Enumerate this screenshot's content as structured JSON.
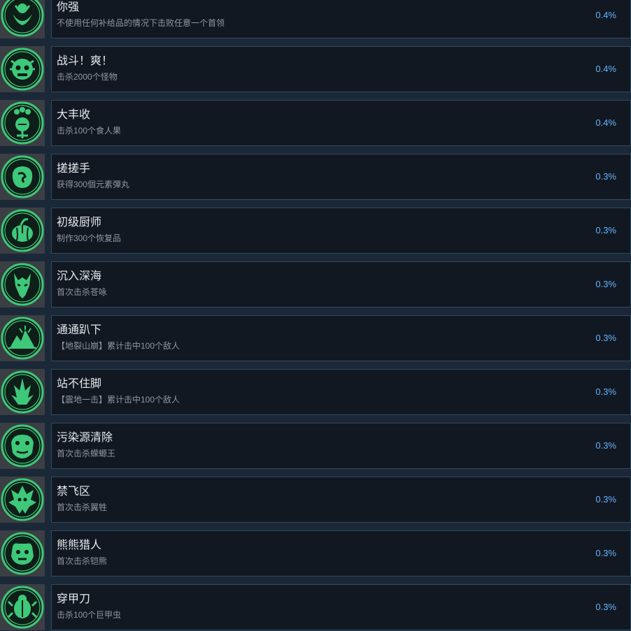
{
  "achievements": [
    {
      "icon": "leaf-flower-icon",
      "title": "你强",
      "desc": "不使用任何补给品的情况下击败任意一个首领",
      "percent": "0.4%"
    },
    {
      "icon": "skull-icon",
      "title": "战斗！爽！",
      "desc": "击杀2000个怪物",
      "percent": "0.4%"
    },
    {
      "icon": "carnivorous-plant-icon",
      "title": "大丰收",
      "desc": "击杀100个食人果",
      "percent": "0.4%"
    },
    {
      "icon": "flower-swirl-icon",
      "title": "搓搓手",
      "desc": "获得300個元素彈丸",
      "percent": "0.3%"
    },
    {
      "icon": "pumpkin-icon",
      "title": "初级厨师",
      "desc": "制作300个恢复品",
      "percent": "0.3%"
    },
    {
      "icon": "dragon-head-icon",
      "title": "沉入深海",
      "desc": "首次击杀苍咏",
      "percent": "0.3%"
    },
    {
      "icon": "mountain-burst-icon",
      "title": "通通趴下",
      "desc": "【地裂山崩】累计击中100个敌人",
      "percent": "0.3%"
    },
    {
      "icon": "flame-spike-icon",
      "title": "站不住脚",
      "desc": "【震地一击】累计击中100个敌人",
      "percent": "0.3%"
    },
    {
      "icon": "toad-king-icon",
      "title": "污染源清除",
      "desc": "首次击杀蝾螈王",
      "percent": "0.3%"
    },
    {
      "icon": "winged-beast-icon",
      "title": "禁飞区",
      "desc": "首次击杀翼牲",
      "percent": "0.3%"
    },
    {
      "icon": "bear-icon",
      "title": "熊熊猎人",
      "desc": "首次击杀铠熊",
      "percent": "0.3%"
    },
    {
      "icon": "beetle-icon",
      "title": "穿甲刀",
      "desc": "击杀100个巨甲虫",
      "percent": "0.3%"
    }
  ],
  "colors": {
    "icon_green": "#3ec87a",
    "icon_dark": "#0e1e18",
    "percent_blue": "#66b3ff"
  }
}
